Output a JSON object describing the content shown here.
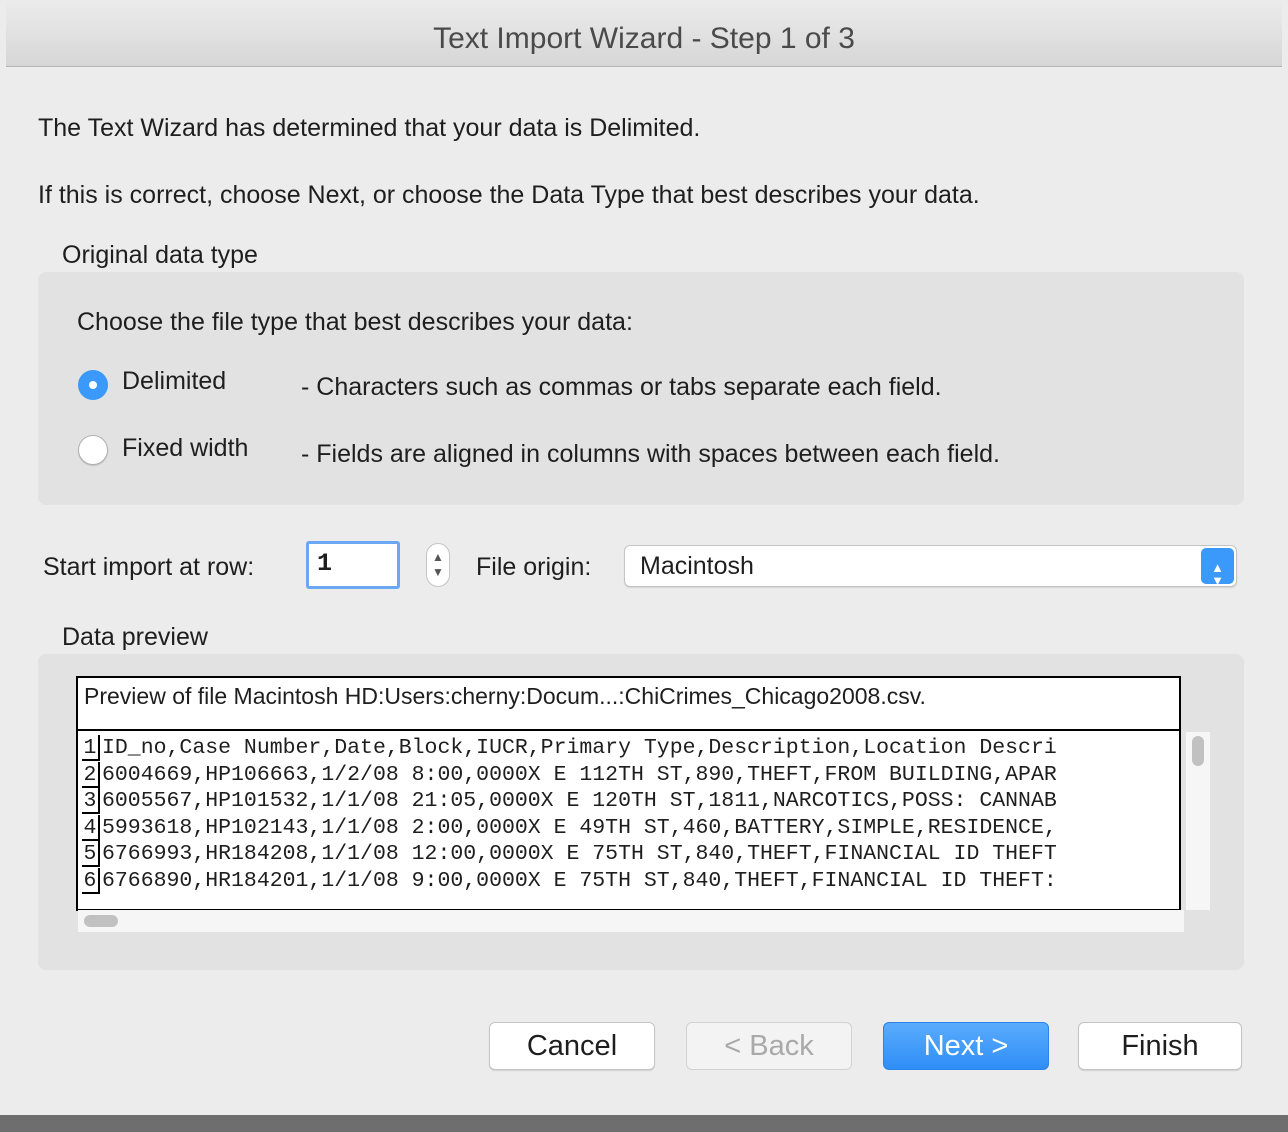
{
  "window": {
    "title": "Text Import Wizard - Step 1 of 3"
  },
  "intro": {
    "line1": "The Text Wizard has determined that your data is Delimited.",
    "line2": "If this is correct, choose Next, or choose the Data Type that best describes your data."
  },
  "original_type": {
    "heading": "Original data type",
    "prompt": "Choose the file type that best describes your data:",
    "options": [
      {
        "label": "Delimited",
        "desc": "- Characters such as commas or tabs separate each field.",
        "selected": true
      },
      {
        "label": "Fixed width",
        "desc": "- Fields are aligned in columns with spaces between each field.",
        "selected": false
      }
    ]
  },
  "import_row": {
    "label": "Start import at row:",
    "value": "1"
  },
  "file_origin": {
    "label": "File origin:",
    "value": "Macintosh"
  },
  "preview": {
    "heading": "Data preview",
    "file_line": "Preview of file Macintosh HD:Users:cherny:Docum...:ChiCrimes_Chicago2008.csv.",
    "rows": [
      {
        "num": "1",
        "text": "ID_no,Case Number,Date,Block,IUCR,Primary Type,Description,Location Descri"
      },
      {
        "num": "2",
        "text": "6004669,HP106663,1/2/08 8:00,0000X E 112TH ST,890,THEFT,FROM BUILDING,APAR"
      },
      {
        "num": "3",
        "text": "6005567,HP101532,1/1/08 21:05,0000X E 120TH ST,1811,NARCOTICS,POSS: CANNAB"
      },
      {
        "num": "4",
        "text": "5993618,HP102143,1/1/08 2:00,0000X E 49TH ST,460,BATTERY,SIMPLE,RESIDENCE,"
      },
      {
        "num": "5",
        "text": "6766993,HR184208,1/1/08 12:00,0000X E 75TH ST,840,THEFT,FINANCIAL ID THEFT"
      },
      {
        "num": "6",
        "text": "6766890,HR184201,1/1/08 9:00,0000X E 75TH ST,840,THEFT,FINANCIAL ID THEFT:"
      }
    ]
  },
  "buttons": {
    "cancel": "Cancel",
    "back": "< Back",
    "next": "Next >",
    "finish": "Finish"
  },
  "colors": {
    "accent": "#3b99fc",
    "background": "#ececec",
    "group": "#e2e2e2"
  }
}
